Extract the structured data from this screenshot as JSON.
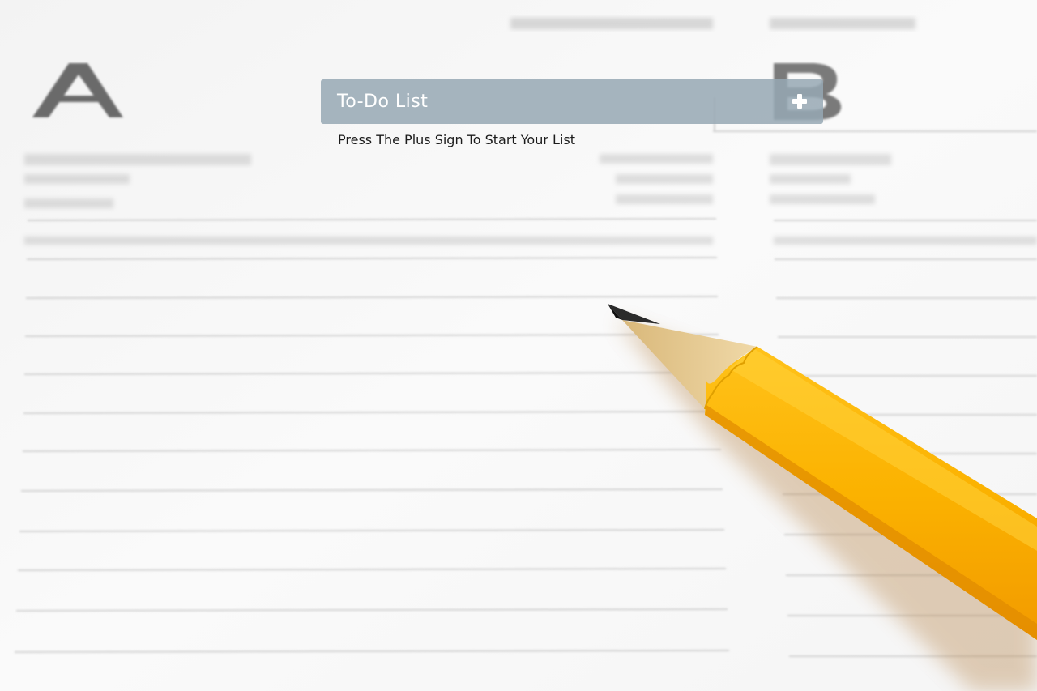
{
  "header": {
    "title": "To-Do List",
    "add_icon": "plus-icon"
  },
  "instructions": {
    "text": "Press The Plus Sign To Start Your List"
  },
  "background": {
    "letters": [
      "A",
      "B"
    ]
  },
  "colors": {
    "header_bg": "#96a8b4",
    "header_text": "#ffffff",
    "instruction_text": "#1c1c1c",
    "pencil_body": "#f9ae00",
    "pencil_wood": "#e9cf9a",
    "pencil_lead": "#2b2b2b",
    "paper": "#f7f7f7"
  }
}
